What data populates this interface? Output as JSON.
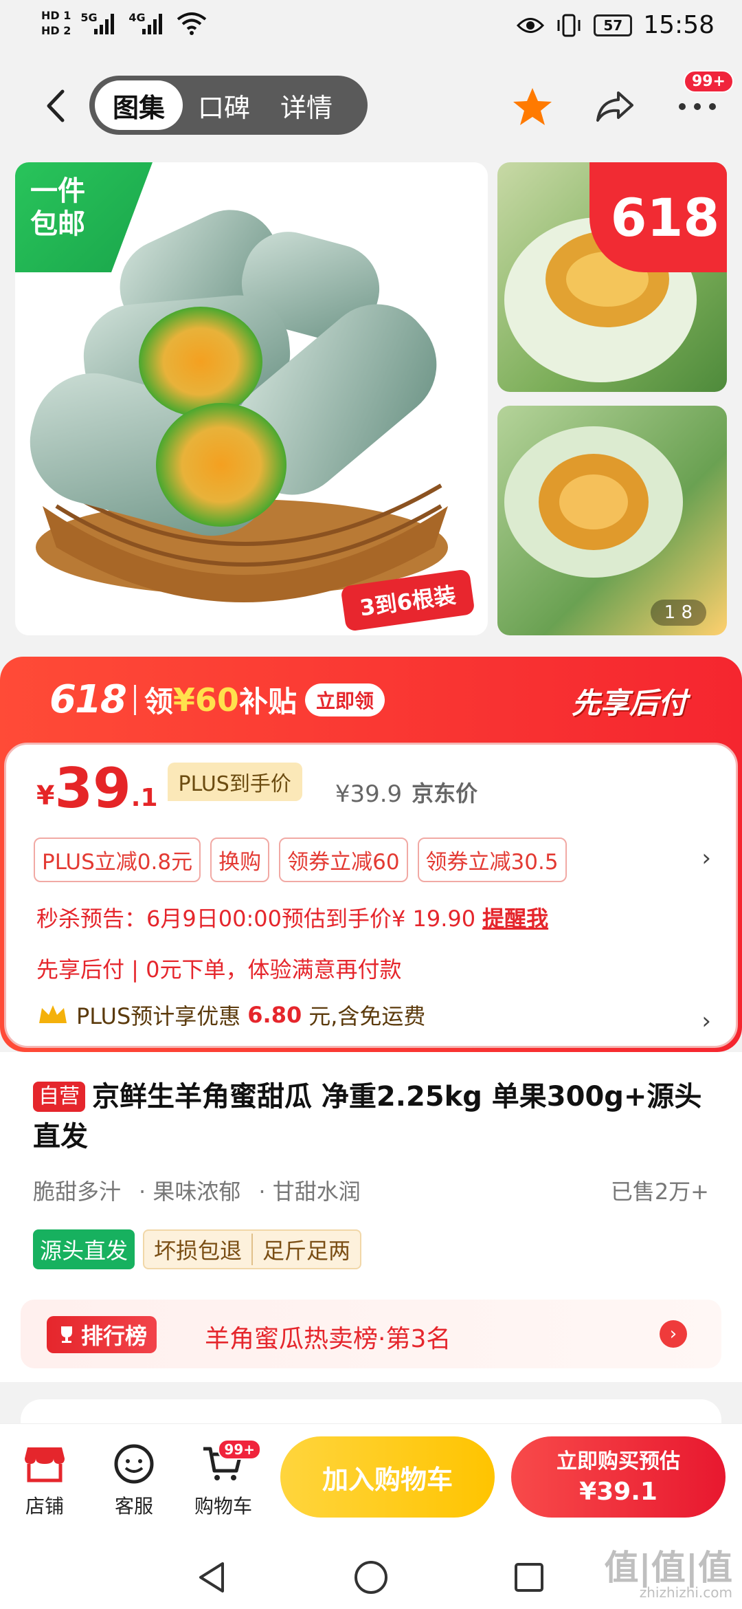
{
  "status_bar": {
    "hd1": "HD 1",
    "hd2": "HD 2",
    "net1": "5G",
    "net2": "4G",
    "battery": "57",
    "time": "15:58"
  },
  "nav": {
    "tabs": [
      "图集",
      "口碑",
      "详情"
    ],
    "active_tab": "图集",
    "more_badge": "99+"
  },
  "gallery": {
    "ribbon": "一件\n包邮",
    "ribbon_line1": "一件",
    "ribbon_line2": "包邮",
    "pack_tag": "3到6根装",
    "promo_618": "618",
    "counter": "1    8"
  },
  "promo": {
    "tag_618": "618",
    "claim_prefix": "领",
    "claim_amount": "¥60",
    "claim_suffix": "补贴",
    "claim_button": "立即领",
    "pay_later": "先享后付"
  },
  "price": {
    "yen": "¥",
    "integer": "39",
    "decimal": ".1",
    "plus_label": "PLUS到手价",
    "original": "¥39.9",
    "original_label": "京东价",
    "coupons": [
      "PLUS立减0.8元",
      "换购",
      "领券立减60",
      "领券立减30.5"
    ],
    "flash_sale": "秒杀预告：6月9日00:00预估到手价¥ 19.90",
    "remind": "提醒我",
    "pay_later_line": "先享后付 | 0元下单，体验满意再付款",
    "plus_benefit_prefix": "PLUS预计享优惠",
    "plus_benefit_amount": "6.80",
    "plus_benefit_suffix": "元,含免运费"
  },
  "product": {
    "self_tag": "自营",
    "title": "京鲜生羊角蜜甜瓜 净重2.25kg 单果300g+源头直发",
    "features": [
      "脆甜多汁",
      "· 果味浓郁",
      "· 甘甜水润"
    ],
    "sold": "已售2万+",
    "tag_source": "源头直发",
    "tag_refund": "坏损包退",
    "tag_weight": "足斤足两"
  },
  "ranking": {
    "badge": "排行榜",
    "text": "羊角蜜瓜热卖榜·第3名"
  },
  "action_bar": {
    "shop": "店铺",
    "service": "客服",
    "cart": "购物车",
    "cart_badge": "99+",
    "add_to_cart": "加入购物车",
    "buy_line1": "立即购买预估",
    "buy_line2": "¥39.1"
  },
  "watermark": {
    "mark": "值|值|值",
    "site": "zhizhizhi.com"
  },
  "colors": {
    "accent_red": "#e5262c",
    "star_orange": "#ff7a00",
    "cart_yellow": "#ffc400",
    "source_green": "#17b15f"
  }
}
